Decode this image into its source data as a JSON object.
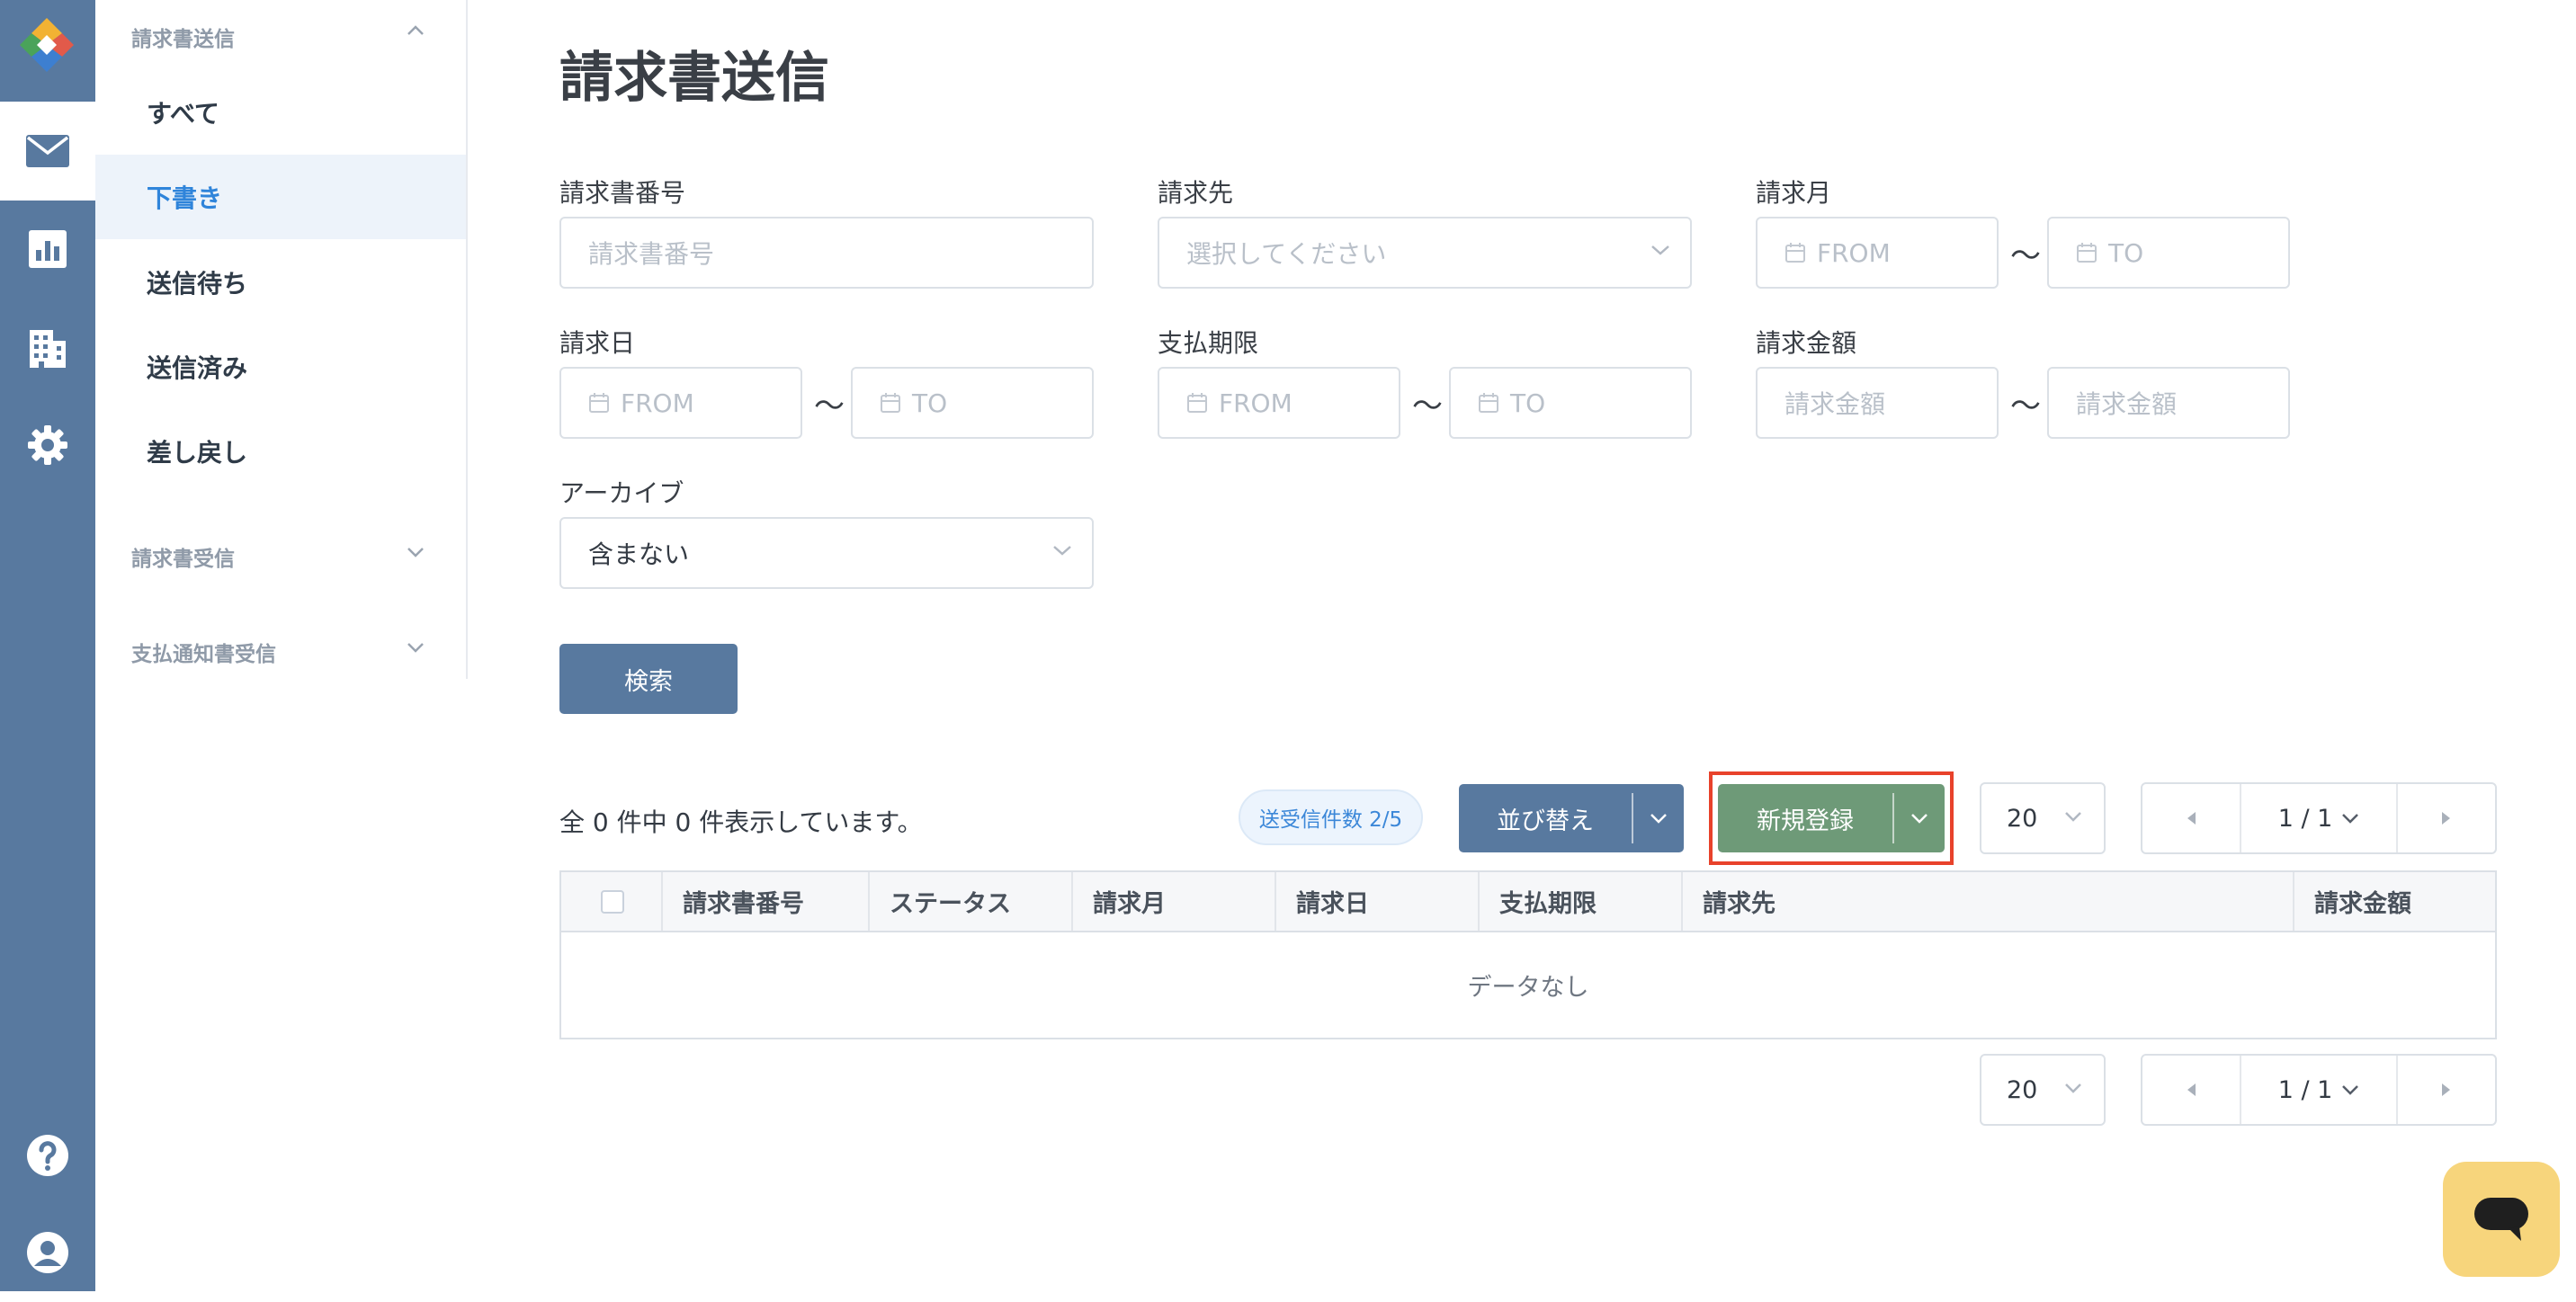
{
  "sidebar": {
    "groups": [
      {
        "title": "請求書送信",
        "expanded": true,
        "items": [
          {
            "label": "すべて"
          },
          {
            "label": "下書き",
            "selected": true
          },
          {
            "label": "送信待ち"
          },
          {
            "label": "送信済み"
          },
          {
            "label": "差し戻し"
          }
        ]
      },
      {
        "title": "請求書受信",
        "expanded": false
      },
      {
        "title": "支払通知書受信",
        "expanded": false
      }
    ]
  },
  "page": {
    "title": "請求書送信"
  },
  "filters": {
    "invoice_number": {
      "label": "請求書番号",
      "placeholder": "請求書番号",
      "value": ""
    },
    "billing_to": {
      "label": "請求先",
      "placeholder": "選択してください"
    },
    "billing_month": {
      "label": "請求月",
      "from": "FROM",
      "to": "TO"
    },
    "invoice_date": {
      "label": "請求日",
      "from": "FROM",
      "to": "TO"
    },
    "due_date": {
      "label": "支払期限",
      "from": "FROM",
      "to": "TO"
    },
    "amount": {
      "label": "請求金額",
      "from_placeholder": "請求金額",
      "to_placeholder": "請求金額"
    },
    "archive": {
      "label": "アーカイブ",
      "value": "含まない"
    },
    "range_separator": "〜",
    "search_button": "検索"
  },
  "results": {
    "summary": "全 0 件中 0 件表示しています。",
    "quota_badge": "送受信件数 2/5",
    "sort_button": "並び替え",
    "new_button": "新規登録",
    "page_size": "20",
    "page_indicator": "1 / 1",
    "columns": [
      "請求書番号",
      "ステータス",
      "請求月",
      "請求日",
      "支払期限",
      "請求先",
      "請求金額"
    ],
    "empty_text": "データなし"
  },
  "colors": {
    "rail": "#58799f",
    "primary_button": "#58799f",
    "new_button": "#6e9a78",
    "highlight_border": "#e8422b",
    "selected_nav_text": "#2f84da",
    "chat_button": "#f7d57c"
  },
  "icons": [
    "app-logo-icon",
    "mail-icon",
    "chart-icon",
    "building-icon",
    "gear-icon",
    "help-icon",
    "user-icon",
    "calendar-icon",
    "chevron-down-icon",
    "chevron-up-icon",
    "caret-left-icon",
    "caret-right-icon",
    "chat-icon"
  ]
}
